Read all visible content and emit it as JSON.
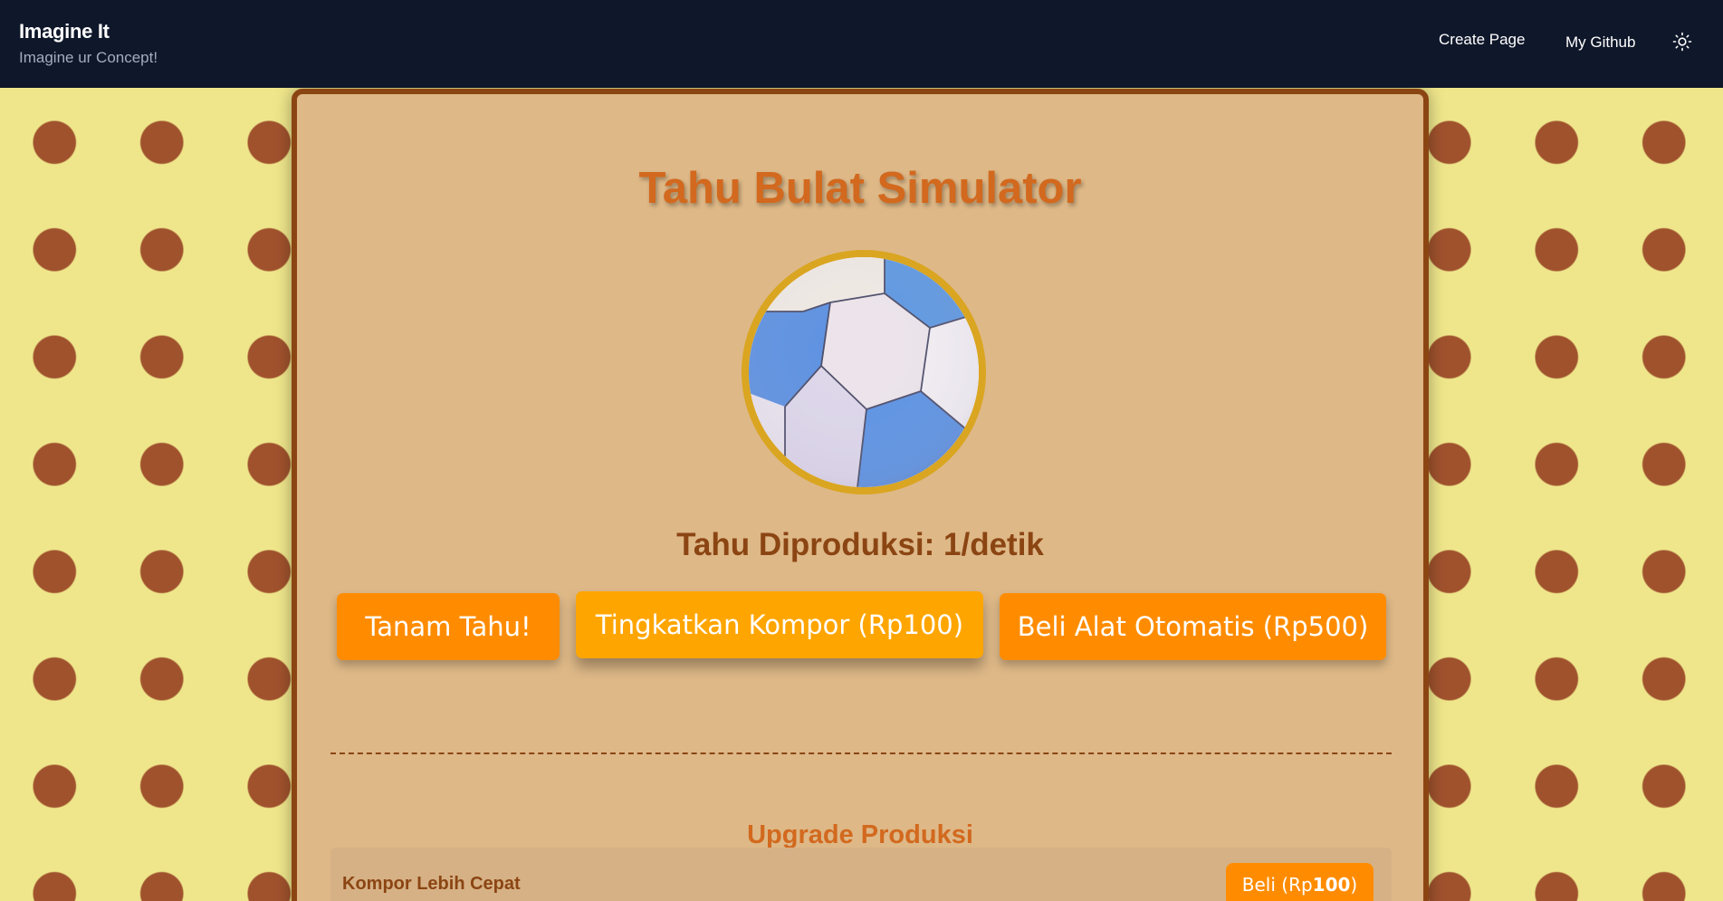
{
  "nav": {
    "brand_title": "Imagine It",
    "brand_subtitle": "Imagine ur Concept!",
    "links": [
      "Create Page",
      "My Github"
    ],
    "theme_icon": "sun-icon"
  },
  "game": {
    "title": "Tahu Bulat Simulator",
    "image_icon": "soccer-ball-image",
    "production_text": "Tahu Diproduksi: 1/detik",
    "buttons": {
      "plant": "Tanam Tahu!",
      "upgrade_stove": "Tingkatkan Kompor (Rp100)",
      "buy_auto": "Beli Alat Otomatis (Rp500)"
    },
    "upgrades_title": "Upgrade Produksi",
    "upgrades": [
      {
        "name": "Kompor Lebih Cepat",
        "buy_prefix": "Beli (Rp",
        "price": "100",
        "buy_suffix": ")"
      }
    ]
  },
  "colors": {
    "navbar": "#0f172a",
    "page_background": "#efe68b",
    "polka_dot": "#a0522d",
    "card": "#deb887",
    "card_border": "#8b4513",
    "title": "#d2691e",
    "button_primary": "#ff8c00",
    "button_secondary": "#ffa500",
    "ball_ring": "#daa520"
  }
}
